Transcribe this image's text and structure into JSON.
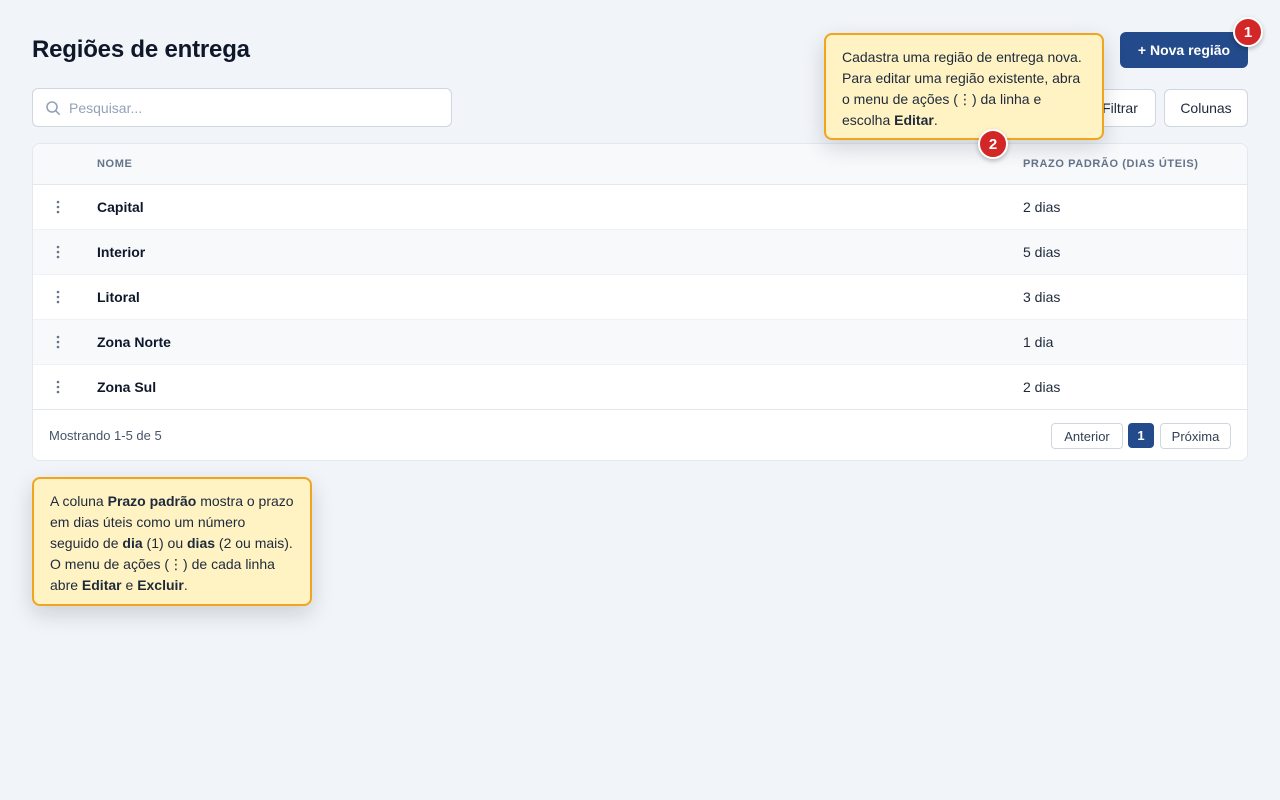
{
  "header": {
    "title": "Regiões de entrega",
    "new_button_label": "+ Nova região"
  },
  "badges": {
    "first": "1",
    "second": "2"
  },
  "toolbar": {
    "search_placeholder": "Pesquisar...",
    "filter_label": "Filtrar",
    "columns_label": "Colunas"
  },
  "tooltip_top": {
    "part1": "Cadastra uma região de entrega nova. Para editar uma região existente, abra o menu de ações (⋮) da linha e escolha ",
    "bold1": "Editar",
    "part2": "."
  },
  "tooltip_bottom": {
    "part1": "A coluna ",
    "bold1": "Prazo padrão",
    "part2": " mostra o prazo em dias úteis como um número seguido de ",
    "bold2": "dia",
    "part3": " (1) ou ",
    "bold3": "dias",
    "part4": " (2 ou mais). O menu de ações (⋮) de cada linha abre ",
    "bold4": "Editar",
    "part5": " e ",
    "bold5": "Excluir",
    "part6": "."
  },
  "table": {
    "columns": [
      "Nome",
      "Prazo padrão (dias úteis)"
    ],
    "rows": [
      {
        "nome": "Capital",
        "prazo": "2 dias"
      },
      {
        "nome": "Interior",
        "prazo": "5 dias"
      },
      {
        "nome": "Litoral",
        "prazo": "3 dias"
      },
      {
        "nome": "Zona Norte",
        "prazo": "1 dia"
      },
      {
        "nome": "Zona Sul",
        "prazo": "2 dias"
      }
    ]
  },
  "footer": {
    "showing": "Mostrando 1-5 de 5",
    "prev_label": "Anterior",
    "current_page": "1",
    "next_label": "Próxima"
  },
  "colors": {
    "primary": "#234a8a",
    "badge": "#d32626",
    "tooltip_bg": "#fff3c4",
    "tooltip_border": "#efa520",
    "page_bg": "#f1f4f8"
  },
  "icons": {
    "search": "search-icon",
    "row_actions": "kebab-menu-icon"
  }
}
